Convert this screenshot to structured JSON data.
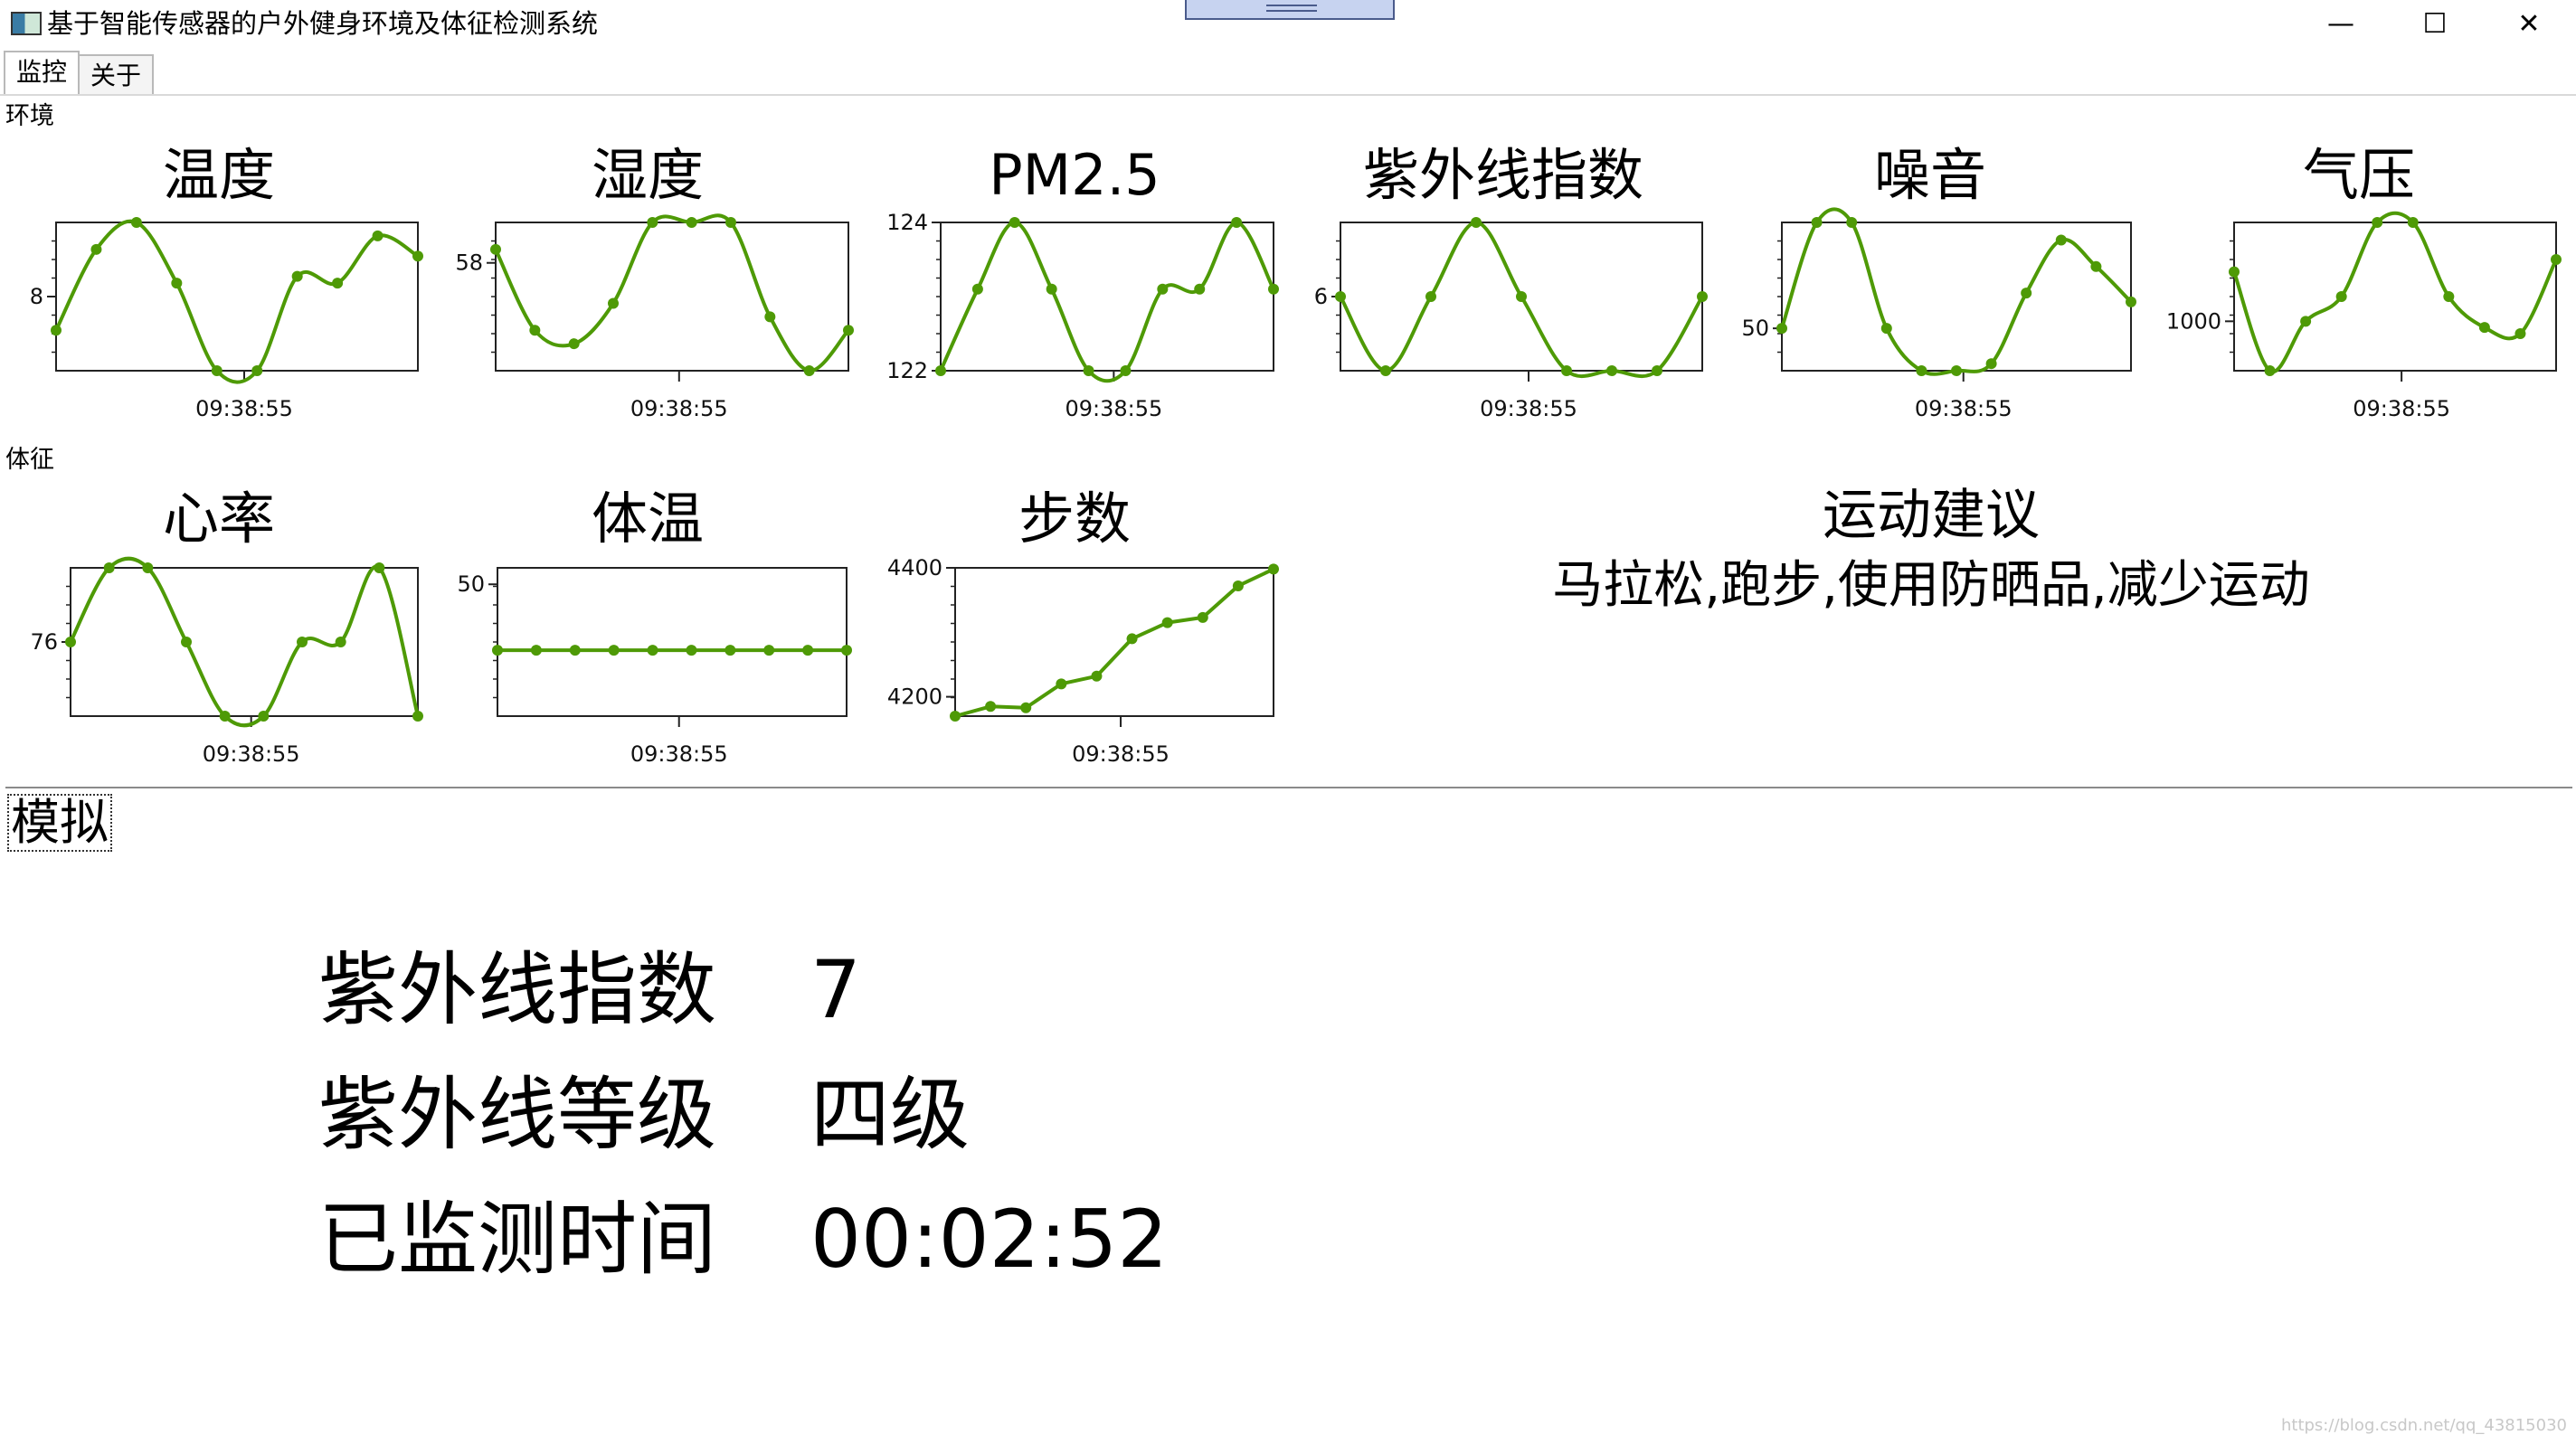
{
  "window": {
    "title": "基于智能传感器的户外健身环境及体征检测系统",
    "minimize_glyph": "—",
    "maximize_glyph": "☐",
    "close_glyph": "✕"
  },
  "tabs": [
    {
      "label": "监控",
      "active": true
    },
    {
      "label": "关于",
      "active": false
    }
  ],
  "sections": {
    "environment_label": "环境",
    "vitals_label": "体征"
  },
  "line_color": "#4e9a06",
  "charts": [
    {
      "id": "temp",
      "title": "温度",
      "time_label": "09:38:55",
      "y_tick_labels": [
        "8"
      ]
    },
    {
      "id": "humidity",
      "title": "湿度",
      "time_label": "09:38:55",
      "y_tick_labels": [
        "58"
      ]
    },
    {
      "id": "pm25",
      "title": "PM2.5",
      "time_label": "09:38:55",
      "y_tick_labels": [
        "124",
        "122"
      ]
    },
    {
      "id": "uv",
      "title": "紫外线指数",
      "time_label": "09:38:55",
      "y_tick_labels": [
        "6"
      ]
    },
    {
      "id": "noise",
      "title": "噪音",
      "time_label": "09:38:55",
      "y_tick_labels": [
        "50"
      ]
    },
    {
      "id": "pressure",
      "title": "气压",
      "time_label": "09:38:55",
      "y_tick_labels": [
        "1000"
      ]
    },
    {
      "id": "heartrate",
      "title": "心率",
      "time_label": "09:38:55",
      "y_tick_labels": [
        "76"
      ]
    },
    {
      "id": "bodytemp",
      "title": "体温",
      "time_label": "09:38:55",
      "y_tick_labels": [
        "50"
      ]
    },
    {
      "id": "steps",
      "title": "步数",
      "time_label": "09:38:55",
      "y_tick_labels": [
        "4400",
        "4200"
      ]
    }
  ],
  "chart_data": [
    {
      "type": "line",
      "title": "温度",
      "y": [
        7.5,
        8.7,
        9.1,
        8.2,
        6.9,
        6.9,
        8.3,
        8.2,
        8.9,
        8.6
      ],
      "ylim": [
        6.9,
        9.1
      ],
      "yticks": [
        {
          "label": "8",
          "value": 8
        }
      ],
      "xticks": [
        "09:38:55"
      ]
    },
    {
      "type": "line",
      "title": "湿度",
      "y": [
        59,
        53,
        52,
        55,
        61,
        61,
        61,
        54,
        50,
        53
      ],
      "ylim": [
        50,
        61
      ],
      "yticks": [
        {
          "label": "58",
          "value": 58
        }
      ],
      "xticks": [
        "09:38:55"
      ]
    },
    {
      "type": "line",
      "title": "PM2.5",
      "y": [
        122,
        123.1,
        124,
        123.1,
        122,
        122,
        123.1,
        123.1,
        124,
        123.1
      ],
      "ylim": [
        122,
        124
      ],
      "yticks": [
        {
          "label": "124",
          "value": 124
        },
        {
          "label": "122",
          "value": 122
        }
      ],
      "xticks": [
        "09:38:55"
      ]
    },
    {
      "type": "line",
      "title": "紫外线指数",
      "y": [
        6,
        5,
        6,
        7,
        6,
        5,
        5,
        5,
        6
      ],
      "ylim": [
        5,
        7
      ],
      "yticks": [
        {
          "label": "6",
          "value": 6
        }
      ],
      "xticks": [
        "09:38:55"
      ]
    },
    {
      "type": "line",
      "title": "噪音",
      "y": [
        50,
        56,
        56,
        50,
        47.6,
        47.6,
        48,
        52,
        55,
        53.5,
        51.5
      ],
      "ylim": [
        47.6,
        56
      ],
      "yticks": [
        {
          "label": "50",
          "value": 50
        }
      ],
      "xticks": [
        "09:38:55"
      ]
    },
    {
      "type": "line",
      "title": "气压",
      "y": [
        1004,
        996,
        1000,
        1002,
        1008,
        1008,
        1002,
        999.5,
        999,
        1005
      ],
      "ylim": [
        996,
        1008
      ],
      "yticks": [
        {
          "label": "1000",
          "value": 1000
        }
      ],
      "xticks": [
        "09:38:55"
      ]
    },
    {
      "type": "line",
      "title": "心率",
      "y": [
        76,
        79,
        79,
        76,
        73,
        73,
        76,
        76,
        79,
        73
      ],
      "ylim": [
        73,
        79
      ],
      "yticks": [
        {
          "label": "76",
          "value": 76
        }
      ],
      "xticks": [
        "09:38:55"
      ]
    },
    {
      "type": "line",
      "title": "体温",
      "y": [
        46,
        46,
        46,
        46,
        46,
        46,
        46,
        46,
        46,
        46
      ],
      "ylim": [
        42,
        51
      ],
      "yticks": [
        {
          "label": "50",
          "value": 50
        }
      ],
      "xticks": [
        "09:38:55"
      ]
    },
    {
      "type": "line",
      "title": "步数",
      "y": [
        4170,
        4185,
        4183,
        4220,
        4232,
        4290,
        4315,
        4323,
        4372,
        4398
      ],
      "ylim": [
        4170,
        4400
      ],
      "yticks": [
        {
          "label": "4400",
          "value": 4400
        },
        {
          "label": "4200",
          "value": 4200
        }
      ],
      "xticks": [
        "09:38:55"
      ]
    }
  ],
  "advice": {
    "title": "运动建议",
    "text": "马拉松,跑步,使用防晒品,减少运动"
  },
  "simulate_button": "模拟",
  "info": [
    {
      "label": "紫外线指数",
      "value": "7"
    },
    {
      "label": "紫外线等级",
      "value": "四级"
    },
    {
      "label": "已监测时间",
      "value": "00:02:52"
    }
  ],
  "watermark": "https://blog.csdn.net/qq_43815030"
}
